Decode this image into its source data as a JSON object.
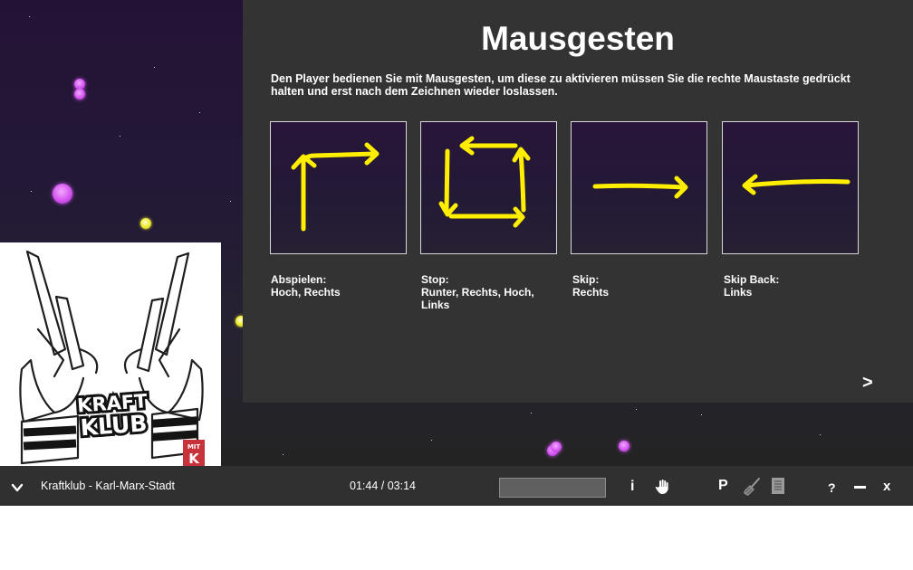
{
  "help": {
    "title": "Mausgesten",
    "intro": "Den Player bedienen Sie mit Mausgesten, um diese zu aktivieren müssen Sie die rechte Maustaste gedrückt halten und erst nach dem Zeichnen wieder loslassen.",
    "gestures": [
      {
        "name": "Abspielen:",
        "directions": "Hoch, Rechts"
      },
      {
        "name": "Stop:",
        "directions": "Runter, Rechts, Hoch, Links"
      },
      {
        "name": "Skip:",
        "directions": "Rechts"
      },
      {
        "name": "Skip Back:",
        "directions": "Links"
      }
    ],
    "next_label": ">",
    "gesture_color": "#ffee00"
  },
  "album": {
    "logo_line1": "KRAFT",
    "logo_line2": "KLUB",
    "badge_line1": "MIT",
    "badge_line2": "K"
  },
  "player": {
    "track": "Kraftklub - Karl-Marx-Stadt",
    "time": "01:44 / 03:14",
    "search_value": "",
    "info_label": "i",
    "playlist_label": "P",
    "help_label": "?",
    "close_label": "x",
    "icons": [
      "chevron-down-icon",
      "hand-icon",
      "broom-icon",
      "notes-icon",
      "minimize-icon"
    ]
  },
  "colors": {
    "background_top": "#241236",
    "panel": "#333333",
    "control_bar": "#303030",
    "orb_pink": "#d455f0",
    "orb_yellow": "#f1ee3a"
  }
}
